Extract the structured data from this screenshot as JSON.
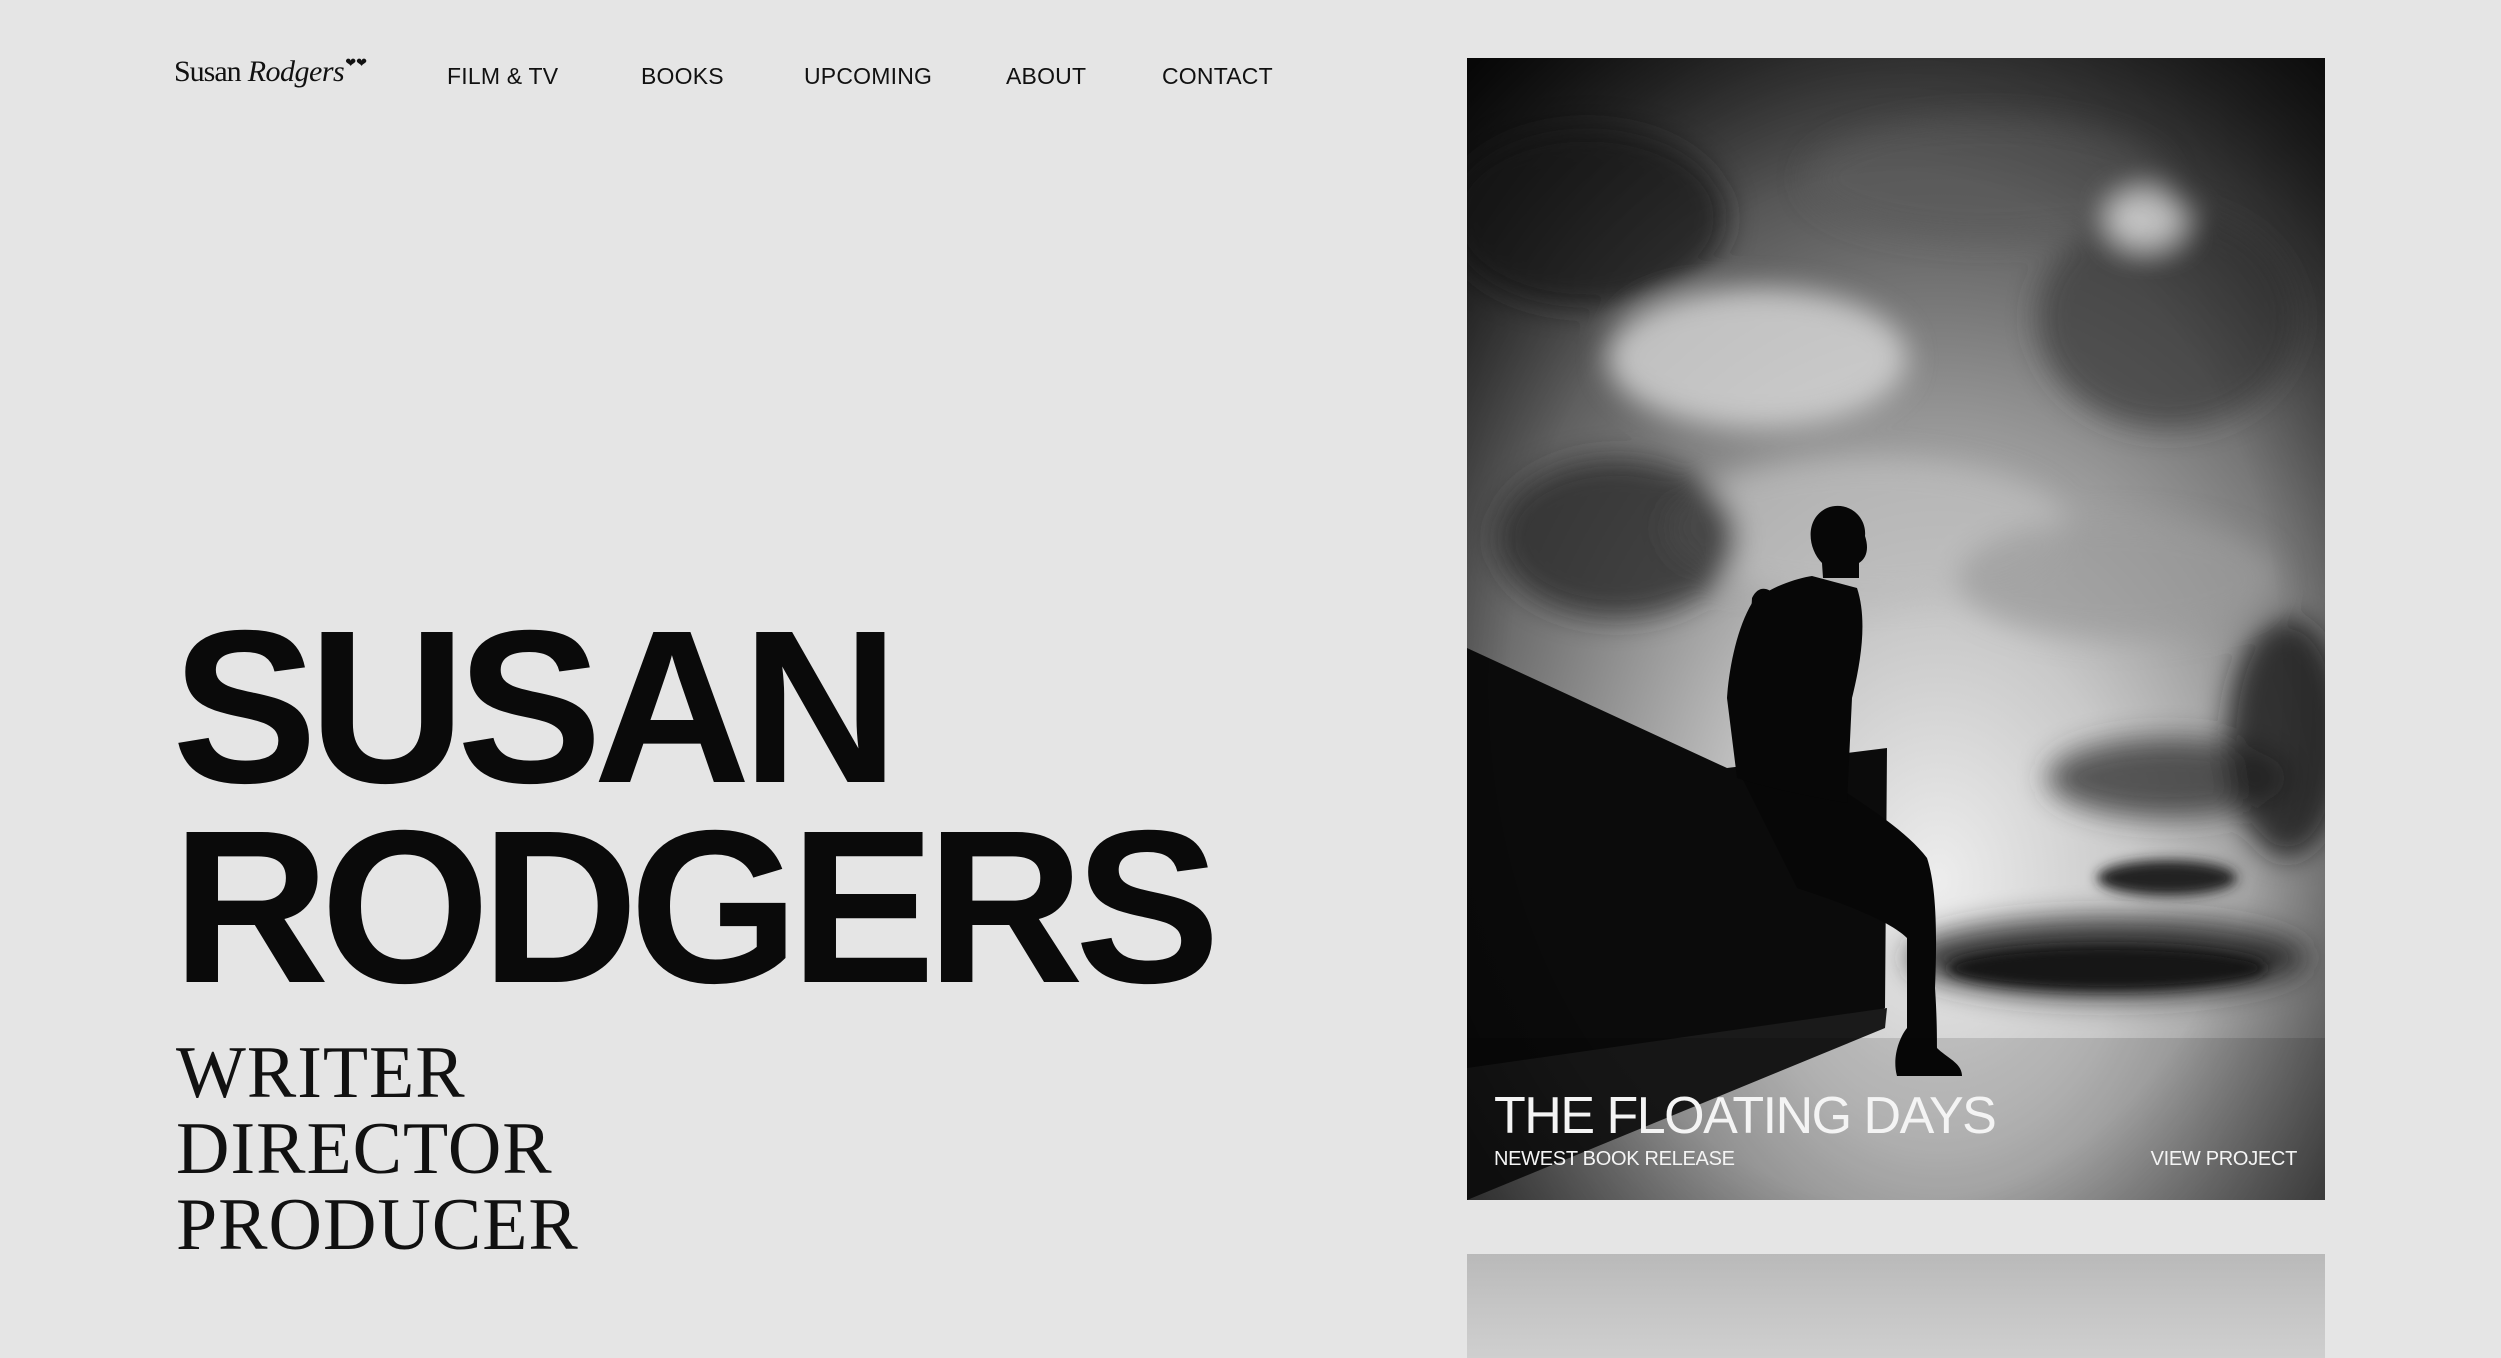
{
  "logo": {
    "first": "Susan",
    "last": "Rodgers",
    "hearts": "❤❤"
  },
  "nav": {
    "items": [
      {
        "label": "FILM & TV"
      },
      {
        "label": "BOOKS"
      },
      {
        "label": "UPCOMING"
      },
      {
        "label": "ABOUT"
      },
      {
        "label": "CONTACT"
      }
    ]
  },
  "hero": {
    "name_line1": "SUSAN",
    "name_line2": "RODGERS",
    "roles": [
      "WRITER",
      "DIRECTOR",
      "PRODUCER"
    ]
  },
  "feature": {
    "title": "THE FLOATING DAYS",
    "subtitle": "NEWEST BOOK RELEASE",
    "link": "VIEW PROJECT",
    "image_icon": "silhouette-on-wall-photo"
  },
  "colors": {
    "background": "#e5e5e5",
    "text": "#0a0a0a",
    "card_text": "#f4f4f4"
  }
}
